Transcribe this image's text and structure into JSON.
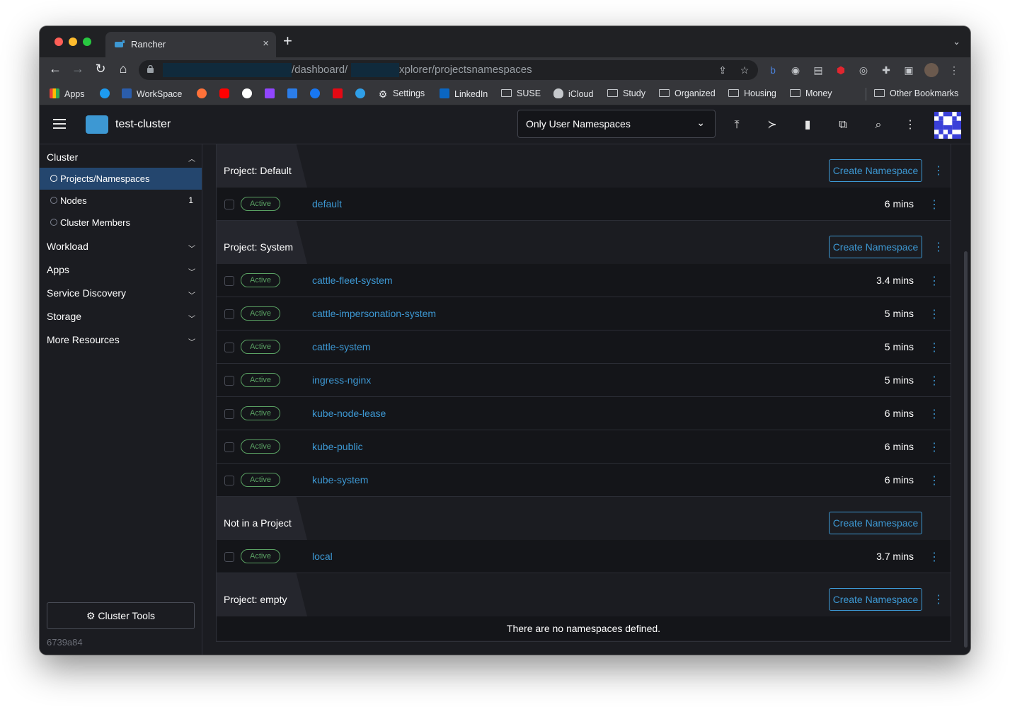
{
  "browser": {
    "tab_title": "Rancher",
    "tab_close": "×",
    "new_tab": "+",
    "url_part1": "/dashboard/",
    "url_part2": "xplorer/projectsnamespaces",
    "bookmarks": [
      {
        "label": "Apps",
        "icon": "apps-grid-icon"
      },
      {
        "label": "",
        "icon": "twitter-icon"
      },
      {
        "label": "WorkSpace",
        "icon": "workspace-icon"
      },
      {
        "label": "",
        "icon": "firefox-relay-icon"
      },
      {
        "label": "",
        "icon": "youtube-icon"
      },
      {
        "label": "",
        "icon": "google-icon"
      },
      {
        "label": "",
        "icon": "twitch-icon"
      },
      {
        "label": "",
        "icon": "bing-icon"
      },
      {
        "label": "",
        "icon": "facebook-icon"
      },
      {
        "label": "",
        "icon": "netflix-icon"
      },
      {
        "label": "",
        "icon": "edge-icon"
      },
      {
        "label": "Settings",
        "icon": "gear-icon"
      },
      {
        "label": "LinkedIn",
        "icon": "linkedin-icon"
      },
      {
        "label": "SUSE",
        "icon": "folder-icon"
      },
      {
        "label": "iCloud",
        "icon": "apple-icon"
      },
      {
        "label": "Study",
        "icon": "folder-icon"
      },
      {
        "label": "Organized",
        "icon": "folder-icon"
      },
      {
        "label": "Housing",
        "icon": "folder-icon"
      },
      {
        "label": "Money",
        "icon": "folder-icon"
      },
      {
        "label": "Other Bookmarks",
        "icon": "folder-icon"
      }
    ]
  },
  "header": {
    "cluster_name": "test-cluster",
    "namespace_filter": "Only User Namespaces"
  },
  "sidebar": {
    "cluster_label": "Cluster",
    "items": [
      {
        "label": "Projects/Namespaces",
        "count": "",
        "active": true
      },
      {
        "label": "Nodes",
        "count": "1",
        "active": false
      },
      {
        "label": "Cluster Members",
        "count": "",
        "active": false
      }
    ],
    "groups": [
      "Workload",
      "Apps",
      "Service Discovery",
      "Storage",
      "More Resources"
    ],
    "cluster_tools": "Cluster Tools",
    "version": "6739a84"
  },
  "main": {
    "create_label": "Create Namespace",
    "status_label": "Active",
    "empty_message": "There are no namespaces defined.",
    "groups": [
      {
        "title": "Project: Default",
        "rows": [
          {
            "name": "default",
            "age": "6 mins"
          }
        ]
      },
      {
        "title": "Project: System",
        "rows": [
          {
            "name": "cattle-fleet-system",
            "age": "3.4 mins"
          },
          {
            "name": "cattle-impersonation-system",
            "age": "5 mins"
          },
          {
            "name": "cattle-system",
            "age": "5 mins"
          },
          {
            "name": "ingress-nginx",
            "age": "5 mins"
          },
          {
            "name": "kube-node-lease",
            "age": "6 mins"
          },
          {
            "name": "kube-public",
            "age": "6 mins"
          },
          {
            "name": "kube-system",
            "age": "6 mins"
          }
        ]
      },
      {
        "title": "Not in a Project",
        "rows": [
          {
            "name": "local",
            "age": "3.7 mins"
          }
        ]
      },
      {
        "title": "Project: empty",
        "rows": []
      }
    ]
  },
  "colors": {
    "accent": "#3d98d3",
    "active_badge": "#5aa163",
    "sidebar_active": "#24466e",
    "background": "#1b1c21"
  }
}
